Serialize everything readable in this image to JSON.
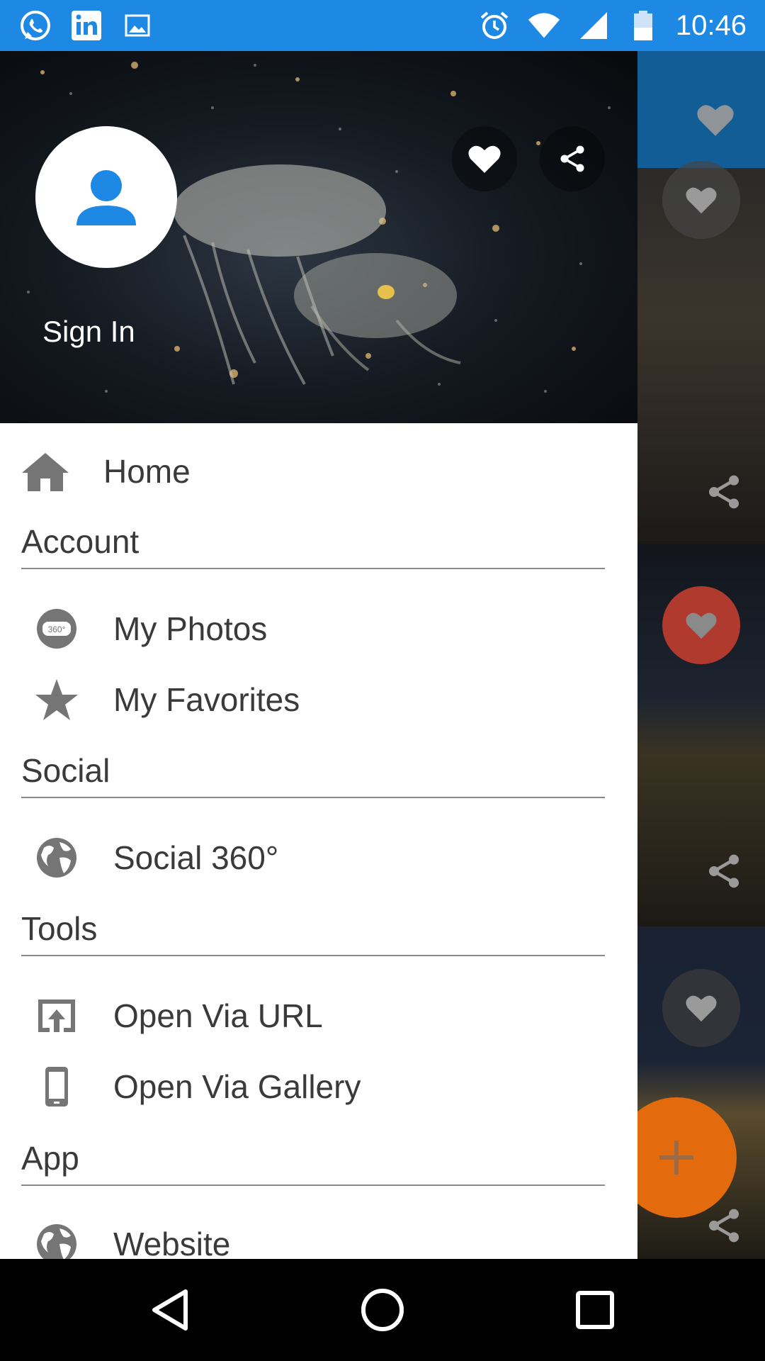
{
  "status_bar": {
    "time": "10:46",
    "left_icons": [
      "whatsapp-icon",
      "linkedin-icon",
      "gallery-icon"
    ],
    "right_icons": [
      "alarm-icon",
      "wifi-icon",
      "signal-icon",
      "battery-icon"
    ]
  },
  "drawer": {
    "header": {
      "sign_in_label": "Sign In",
      "buttons": [
        "heart-icon",
        "share-icon"
      ]
    },
    "items": {
      "home": "Home",
      "account_section": "Account",
      "my_photos": "My Photos",
      "my_favorites": "My Favorites",
      "social_section": "Social",
      "social_360": "Social 360°",
      "tools_section": "Tools",
      "open_url": "Open Via URL",
      "open_gallery": "Open Via Gallery",
      "app_section": "App",
      "website": "Website"
    },
    "photo_badge": "360°"
  },
  "colors": {
    "status_bar": "#1e88e5",
    "avatar_icon": "#1e88e5",
    "fab": "#e36a0d",
    "liked_heart": "#c0392b",
    "menu_text": "#3a3a3a",
    "menu_icon": "#757575"
  },
  "navbar": [
    "back-icon",
    "home-circle-icon",
    "recents-icon"
  ]
}
